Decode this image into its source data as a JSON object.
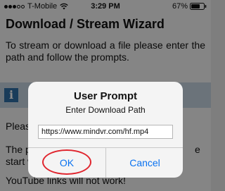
{
  "status_bar": {
    "carrier": "T-Mobile",
    "time": "3:29 PM",
    "battery": "67%"
  },
  "page": {
    "title": "Download / Stream Wizard",
    "intro": "To stream or download a file please enter the path and follow the prompts.",
    "paragraph_1": "Please",
    "paragraph_2_start": "The p",
    "paragraph_2_end": "e",
    "paragraph_2_line2": "start w",
    "paragraph_3": "YouTube links will not work!"
  },
  "dialog": {
    "title": "User Prompt",
    "message": "Enter Download Path",
    "input_value": "https://www.mindvr.com/hf.mp4",
    "ok_label": "OK",
    "cancel_label": "Cancel"
  },
  "colors": {
    "accent": "#0a72f0",
    "annotation": "#e0252e",
    "info_banner": "#c4d2de",
    "info_icon": "#2f6ea5"
  },
  "icons": {
    "info": "i"
  }
}
